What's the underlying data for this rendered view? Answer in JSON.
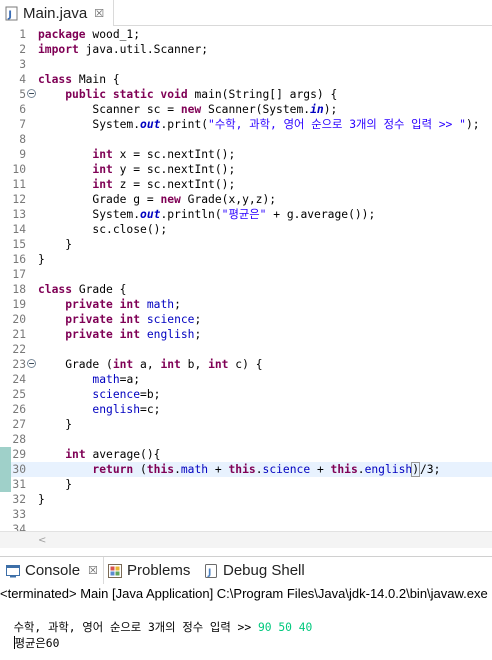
{
  "editor": {
    "tab": {
      "title": "Main.java",
      "close_glyph": "☒"
    },
    "current_line": 30,
    "change_marked_lines": [
      29,
      30,
      31
    ],
    "fold_lines": [
      5,
      23
    ],
    "lines": [
      {
        "n": 1,
        "tokens": [
          [
            "kw",
            "package"
          ],
          [
            "",
            "wood_1;"
          ]
        ]
      },
      {
        "n": 2,
        "tokens": [
          [
            "kw",
            "import"
          ],
          [
            "",
            "java.util.Scanner;"
          ]
        ]
      },
      {
        "n": 3,
        "tokens": []
      },
      {
        "n": 4,
        "tokens": [
          [
            "kw",
            "class"
          ],
          [
            "",
            "Main {"
          ]
        ]
      },
      {
        "n": 5,
        "tokens": [
          [
            "",
            "    "
          ],
          [
            "kw",
            "public static void"
          ],
          [
            "",
            "main(String[] args) {"
          ]
        ]
      },
      {
        "n": 6,
        "tokens": [
          [
            "",
            "        Scanner sc = "
          ],
          [
            "kw",
            "new"
          ],
          [
            "",
            "Scanner(System."
          ],
          [
            "sfld",
            "in"
          ],
          [
            "",
            ");"
          ]
        ]
      },
      {
        "n": 7,
        "tokens": [
          [
            "",
            "        System."
          ],
          [
            "sfld",
            "out"
          ],
          [
            "",
            ".print("
          ],
          [
            "str",
            "\"수학, 과학, 영어 순으로 3개의 정수 입력 >> \""
          ],
          [
            "",
            ");"
          ]
        ]
      },
      {
        "n": 8,
        "tokens": []
      },
      {
        "n": 9,
        "tokens": [
          [
            "",
            "        "
          ],
          [
            "kw",
            "int"
          ],
          [
            "",
            "x = sc.nextInt();"
          ]
        ]
      },
      {
        "n": 10,
        "tokens": [
          [
            "",
            "        "
          ],
          [
            "kw",
            "int"
          ],
          [
            "",
            "y = sc.nextInt();"
          ]
        ]
      },
      {
        "n": 11,
        "tokens": [
          [
            "",
            "        "
          ],
          [
            "kw",
            "int"
          ],
          [
            "",
            "z = sc.nextInt();"
          ]
        ]
      },
      {
        "n": 12,
        "tokens": [
          [
            "",
            "        Grade g = "
          ],
          [
            "kw",
            "new"
          ],
          [
            "",
            "Grade(x,y,z);"
          ]
        ]
      },
      {
        "n": 13,
        "tokens": [
          [
            "",
            "        System."
          ],
          [
            "sfld",
            "out"
          ],
          [
            "",
            ".println("
          ],
          [
            "str",
            "\"평균은\""
          ],
          [
            "",
            " + g.average());"
          ]
        ]
      },
      {
        "n": 14,
        "tokens": [
          [
            "",
            "        sc.close();"
          ]
        ]
      },
      {
        "n": 15,
        "tokens": [
          [
            "",
            "    }"
          ]
        ]
      },
      {
        "n": 16,
        "tokens": [
          [
            "",
            "}"
          ]
        ]
      },
      {
        "n": 17,
        "tokens": []
      },
      {
        "n": 18,
        "tokens": [
          [
            "kw",
            "class"
          ],
          [
            "",
            "Grade {"
          ]
        ]
      },
      {
        "n": 19,
        "tokens": [
          [
            "",
            "    "
          ],
          [
            "kw",
            "private int"
          ],
          [
            "fld",
            "math"
          ],
          [
            "",
            ";"
          ]
        ]
      },
      {
        "n": 20,
        "tokens": [
          [
            "",
            "    "
          ],
          [
            "kw",
            "private int"
          ],
          [
            "fld",
            "science"
          ],
          [
            "",
            ";"
          ]
        ]
      },
      {
        "n": 21,
        "tokens": [
          [
            "",
            "    "
          ],
          [
            "kw",
            "private int"
          ],
          [
            "fld",
            "english"
          ],
          [
            "",
            ";"
          ]
        ]
      },
      {
        "n": 22,
        "tokens": []
      },
      {
        "n": 23,
        "tokens": [
          [
            "",
            "    Grade ("
          ],
          [
            "kw",
            "int"
          ],
          [
            "",
            "a, "
          ],
          [
            "kw",
            "int"
          ],
          [
            "",
            "b, "
          ],
          [
            "kw",
            "int"
          ],
          [
            "",
            "c) {"
          ]
        ]
      },
      {
        "n": 24,
        "tokens": [
          [
            "",
            "        "
          ],
          [
            "fld",
            "math"
          ],
          [
            "",
            "=a;"
          ]
        ]
      },
      {
        "n": 25,
        "tokens": [
          [
            "",
            "        "
          ],
          [
            "fld",
            "science"
          ],
          [
            "",
            "=b;"
          ]
        ]
      },
      {
        "n": 26,
        "tokens": [
          [
            "",
            "        "
          ],
          [
            "fld",
            "english"
          ],
          [
            "",
            "=c;"
          ]
        ]
      },
      {
        "n": 27,
        "tokens": [
          [
            "",
            "    }"
          ]
        ]
      },
      {
        "n": 28,
        "tokens": []
      },
      {
        "n": 29,
        "tokens": [
          [
            "",
            "    "
          ],
          [
            "kw",
            "int"
          ],
          [
            "",
            "average(){"
          ]
        ]
      },
      {
        "n": 30,
        "tokens": [
          [
            "",
            "        "
          ],
          [
            "kw",
            "return"
          ],
          [
            "",
            " ("
          ],
          [
            "kw",
            "this"
          ],
          [
            "",
            "."
          ],
          [
            "fld",
            "math"
          ],
          [
            "",
            " + "
          ],
          [
            "kw",
            "this"
          ],
          [
            "",
            "."
          ],
          [
            "fld",
            "science"
          ],
          [
            "",
            " + "
          ],
          [
            "kw",
            "this"
          ],
          [
            "",
            "."
          ],
          [
            "fld",
            "english"
          ],
          [
            "box",
            ")"
          ],
          [
            "caret",
            ""
          ],
          [
            "",
            "/3;"
          ]
        ]
      },
      {
        "n": 31,
        "tokens": [
          [
            "",
            "    }"
          ]
        ]
      },
      {
        "n": 32,
        "tokens": [
          [
            "",
            "}"
          ]
        ]
      },
      {
        "n": 33,
        "tokens": []
      },
      {
        "n": 34,
        "tokens": []
      }
    ]
  },
  "console": {
    "tabs": [
      {
        "id": "console",
        "label": "Console",
        "icon": "console-icon",
        "close_glyph": "☒",
        "active": true
      },
      {
        "id": "problems",
        "label": "Problems",
        "icon": "problems-icon"
      },
      {
        "id": "debug",
        "label": "Debug Shell",
        "icon": "debug-shell-icon"
      }
    ],
    "header": "<terminated> Main [Java Application] C:\\Program Files\\Java\\jdk-14.0.2\\bin\\javaw.exe",
    "output": [
      {
        "prompt": "수학, 과학, 영어 순으로 3개의 정수 입력 >> ",
        "input": "90 50 40"
      },
      {
        "prompt": "평균은60",
        "input": ""
      }
    ]
  },
  "colors": {
    "keyword": "#7f0055",
    "string": "#2a00ff",
    "field": "#0000c0",
    "console_input": "#00c87d",
    "current_line_bg": "#e8f2fe",
    "change_marker": "#9fd0c9"
  }
}
